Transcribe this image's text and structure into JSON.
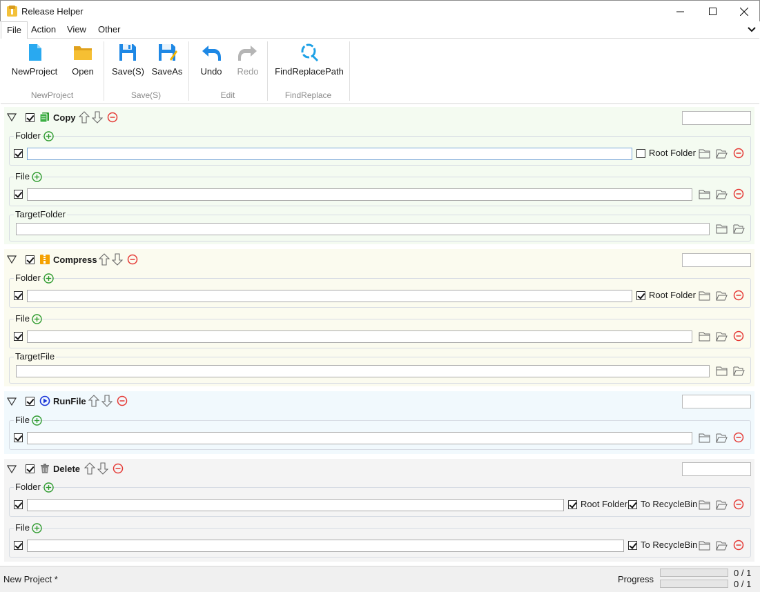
{
  "window": {
    "title": "Release Helper"
  },
  "menu": {
    "items": [
      "File",
      "Action",
      "View",
      "Other"
    ],
    "active": "File"
  },
  "ribbon": {
    "buttons": {
      "new_project": "NewProject",
      "open": "Open",
      "save": "Save(S)",
      "save_as": "SaveAs",
      "undo": "Undo",
      "redo": "Redo",
      "find_replace_path": "FindReplacePath"
    },
    "groups": {
      "new_project": "NewProject",
      "save": "Save(S)",
      "edit": "Edit",
      "find_replace": "FindReplace"
    }
  },
  "sections": {
    "copy": {
      "title": "Copy",
      "checked": true,
      "folder_label": "Folder",
      "file_label": "File",
      "target_label": "TargetFolder",
      "root_folder_label": "Root Folder",
      "root_folder_checked": false
    },
    "compress": {
      "title": "Compress",
      "checked": true,
      "folder_label": "Folder",
      "file_label": "File",
      "target_label": "TargetFile",
      "root_folder_label": "Root Folder",
      "root_folder_checked": true
    },
    "runfile": {
      "title": "RunFile",
      "checked": true,
      "file_label": "File"
    },
    "delete": {
      "title": "Delete",
      "checked": true,
      "folder_label": "Folder",
      "file_label": "File",
      "root_folder_label": "Root Folder",
      "recycle_label": "To RecycleBin"
    }
  },
  "status": {
    "project": "New Project  *",
    "progress_label": "Progress",
    "progress1": "0 / 1",
    "progress2": "0 / 1",
    "progress1_fraction": 0,
    "progress2_fraction": 0
  },
  "colors": {
    "copy_bg": "#f4fbf1",
    "compress_bg": "#fbfbef",
    "runfile_bg": "#f1f9fd",
    "delete_bg": "#f4f4f4",
    "accent_blue": "#1e88e5",
    "remove_red": "#e53935",
    "add_green": "#2e9b2e"
  }
}
